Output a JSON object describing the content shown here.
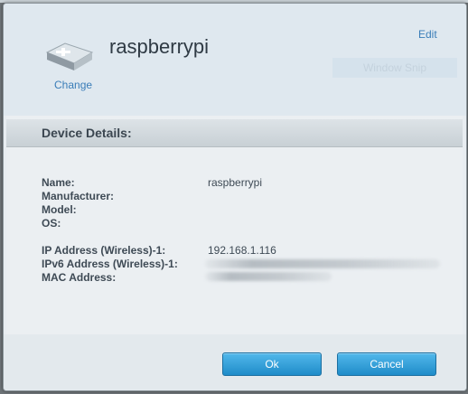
{
  "header": {
    "device_name": "raspberrypi",
    "change_label": "Change",
    "edit_label": "Edit",
    "snip_ghost": "Window Snip"
  },
  "details": {
    "title": "Device Details:",
    "rows": [
      {
        "label": "Name:",
        "value": "raspberrypi"
      },
      {
        "label": "Manufacturer:",
        "value": ""
      },
      {
        "label": "Model:",
        "value": ""
      },
      {
        "label": "OS:",
        "value": ""
      },
      {
        "label": "IP Address (Wireless)-1:",
        "value": "192.168.1.116"
      },
      {
        "label": "IPv6 Address (Wireless)-1:",
        "value": ""
      },
      {
        "label": "MAC Address:",
        "value": ""
      }
    ]
  },
  "buttons": {
    "ok_label": "Ok",
    "cancel_label": "Cancel"
  },
  "colors": {
    "link": "#3a7db8",
    "button": "#2a9ad6"
  }
}
